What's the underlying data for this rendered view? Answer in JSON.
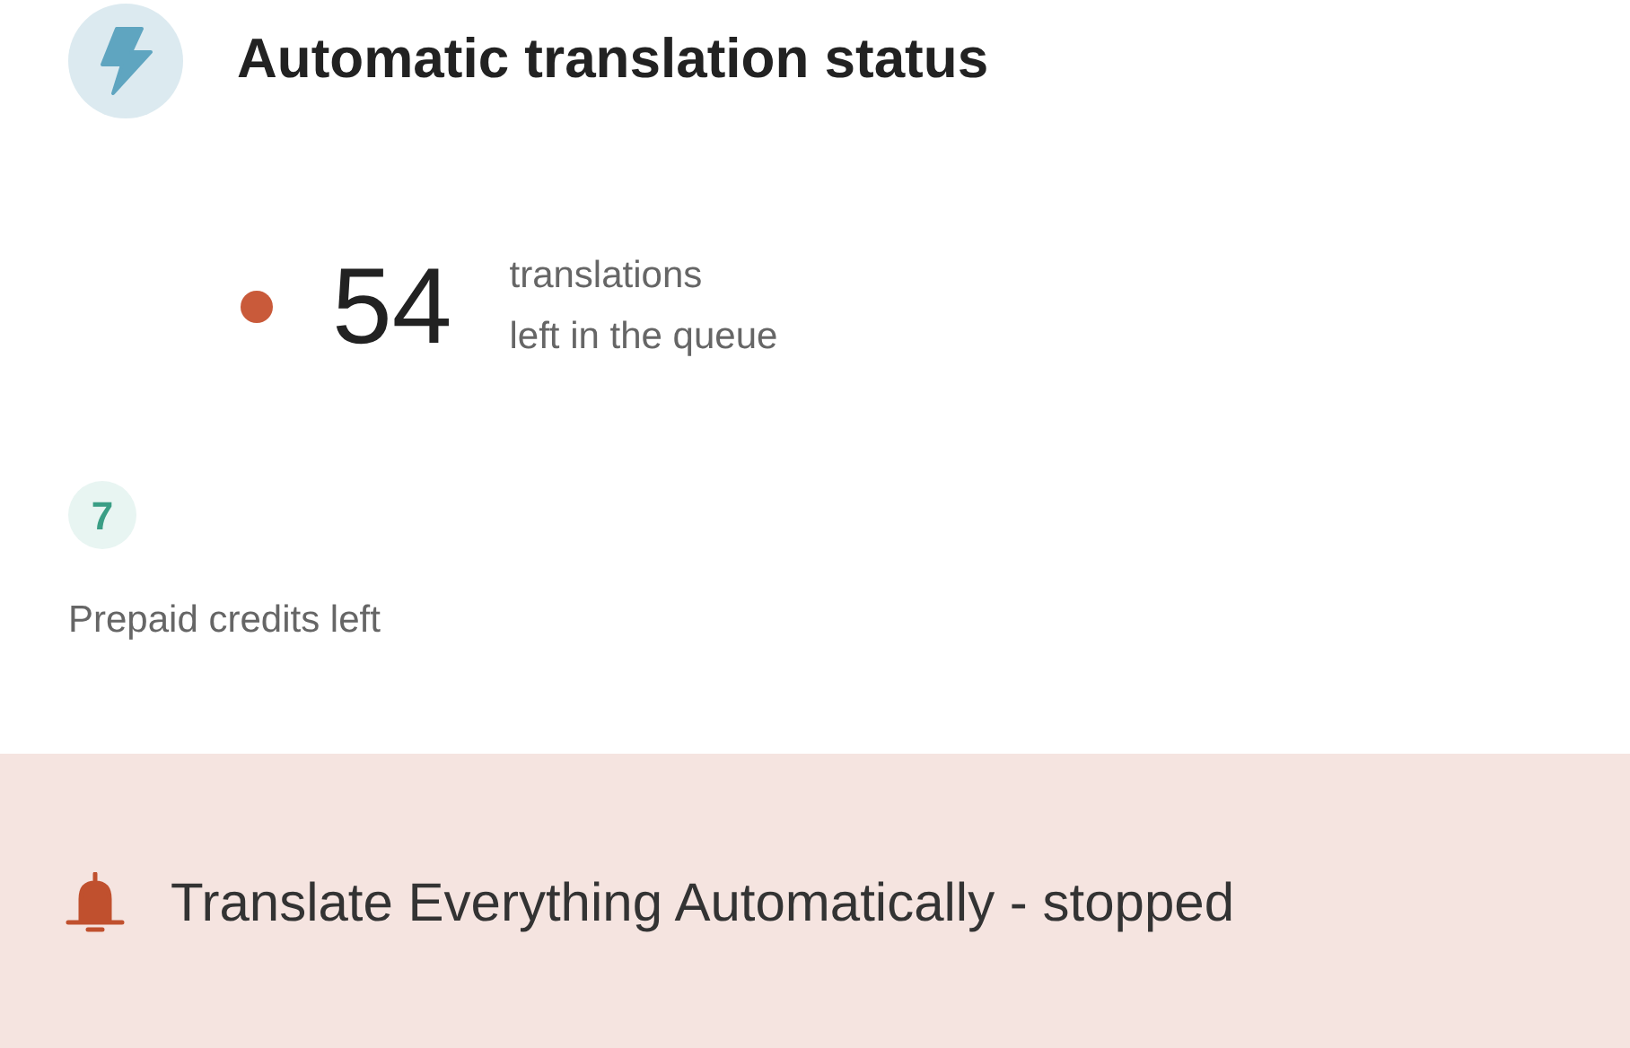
{
  "header": {
    "title": "Automatic translation status"
  },
  "queue": {
    "count": "54",
    "label_lines": [
      "translations",
      "left in the queue"
    ]
  },
  "credits": {
    "count": "7",
    "label": "Prepaid credits left"
  },
  "banner": {
    "text": "Translate Everything Automatically - stopped"
  }
}
